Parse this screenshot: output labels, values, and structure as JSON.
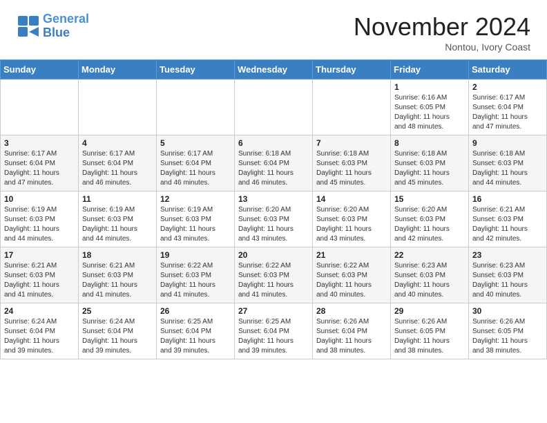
{
  "header": {
    "logo_line1": "General",
    "logo_line2": "Blue",
    "month": "November 2024",
    "location": "Nontou, Ivory Coast"
  },
  "weekdays": [
    "Sunday",
    "Monday",
    "Tuesday",
    "Wednesday",
    "Thursday",
    "Friday",
    "Saturday"
  ],
  "weeks": [
    [
      {
        "day": "",
        "info": ""
      },
      {
        "day": "",
        "info": ""
      },
      {
        "day": "",
        "info": ""
      },
      {
        "day": "",
        "info": ""
      },
      {
        "day": "",
        "info": ""
      },
      {
        "day": "1",
        "info": "Sunrise: 6:16 AM\nSunset: 6:05 PM\nDaylight: 11 hours\nand 48 minutes."
      },
      {
        "day": "2",
        "info": "Sunrise: 6:17 AM\nSunset: 6:04 PM\nDaylight: 11 hours\nand 47 minutes."
      }
    ],
    [
      {
        "day": "3",
        "info": "Sunrise: 6:17 AM\nSunset: 6:04 PM\nDaylight: 11 hours\nand 47 minutes."
      },
      {
        "day": "4",
        "info": "Sunrise: 6:17 AM\nSunset: 6:04 PM\nDaylight: 11 hours\nand 46 minutes."
      },
      {
        "day": "5",
        "info": "Sunrise: 6:17 AM\nSunset: 6:04 PM\nDaylight: 11 hours\nand 46 minutes."
      },
      {
        "day": "6",
        "info": "Sunrise: 6:18 AM\nSunset: 6:04 PM\nDaylight: 11 hours\nand 46 minutes."
      },
      {
        "day": "7",
        "info": "Sunrise: 6:18 AM\nSunset: 6:03 PM\nDaylight: 11 hours\nand 45 minutes."
      },
      {
        "day": "8",
        "info": "Sunrise: 6:18 AM\nSunset: 6:03 PM\nDaylight: 11 hours\nand 45 minutes."
      },
      {
        "day": "9",
        "info": "Sunrise: 6:18 AM\nSunset: 6:03 PM\nDaylight: 11 hours\nand 44 minutes."
      }
    ],
    [
      {
        "day": "10",
        "info": "Sunrise: 6:19 AM\nSunset: 6:03 PM\nDaylight: 11 hours\nand 44 minutes."
      },
      {
        "day": "11",
        "info": "Sunrise: 6:19 AM\nSunset: 6:03 PM\nDaylight: 11 hours\nand 44 minutes."
      },
      {
        "day": "12",
        "info": "Sunrise: 6:19 AM\nSunset: 6:03 PM\nDaylight: 11 hours\nand 43 minutes."
      },
      {
        "day": "13",
        "info": "Sunrise: 6:20 AM\nSunset: 6:03 PM\nDaylight: 11 hours\nand 43 minutes."
      },
      {
        "day": "14",
        "info": "Sunrise: 6:20 AM\nSunset: 6:03 PM\nDaylight: 11 hours\nand 43 minutes."
      },
      {
        "day": "15",
        "info": "Sunrise: 6:20 AM\nSunset: 6:03 PM\nDaylight: 11 hours\nand 42 minutes."
      },
      {
        "day": "16",
        "info": "Sunrise: 6:21 AM\nSunset: 6:03 PM\nDaylight: 11 hours\nand 42 minutes."
      }
    ],
    [
      {
        "day": "17",
        "info": "Sunrise: 6:21 AM\nSunset: 6:03 PM\nDaylight: 11 hours\nand 41 minutes."
      },
      {
        "day": "18",
        "info": "Sunrise: 6:21 AM\nSunset: 6:03 PM\nDaylight: 11 hours\nand 41 minutes."
      },
      {
        "day": "19",
        "info": "Sunrise: 6:22 AM\nSunset: 6:03 PM\nDaylight: 11 hours\nand 41 minutes."
      },
      {
        "day": "20",
        "info": "Sunrise: 6:22 AM\nSunset: 6:03 PM\nDaylight: 11 hours\nand 41 minutes."
      },
      {
        "day": "21",
        "info": "Sunrise: 6:22 AM\nSunset: 6:03 PM\nDaylight: 11 hours\nand 40 minutes."
      },
      {
        "day": "22",
        "info": "Sunrise: 6:23 AM\nSunset: 6:03 PM\nDaylight: 11 hours\nand 40 minutes."
      },
      {
        "day": "23",
        "info": "Sunrise: 6:23 AM\nSunset: 6:03 PM\nDaylight: 11 hours\nand 40 minutes."
      }
    ],
    [
      {
        "day": "24",
        "info": "Sunrise: 6:24 AM\nSunset: 6:04 PM\nDaylight: 11 hours\nand 39 minutes."
      },
      {
        "day": "25",
        "info": "Sunrise: 6:24 AM\nSunset: 6:04 PM\nDaylight: 11 hours\nand 39 minutes."
      },
      {
        "day": "26",
        "info": "Sunrise: 6:25 AM\nSunset: 6:04 PM\nDaylight: 11 hours\nand 39 minutes."
      },
      {
        "day": "27",
        "info": "Sunrise: 6:25 AM\nSunset: 6:04 PM\nDaylight: 11 hours\nand 39 minutes."
      },
      {
        "day": "28",
        "info": "Sunrise: 6:26 AM\nSunset: 6:04 PM\nDaylight: 11 hours\nand 38 minutes."
      },
      {
        "day": "29",
        "info": "Sunrise: 6:26 AM\nSunset: 6:05 PM\nDaylight: 11 hours\nand 38 minutes."
      },
      {
        "day": "30",
        "info": "Sunrise: 6:26 AM\nSunset: 6:05 PM\nDaylight: 11 hours\nand 38 minutes."
      }
    ]
  ]
}
